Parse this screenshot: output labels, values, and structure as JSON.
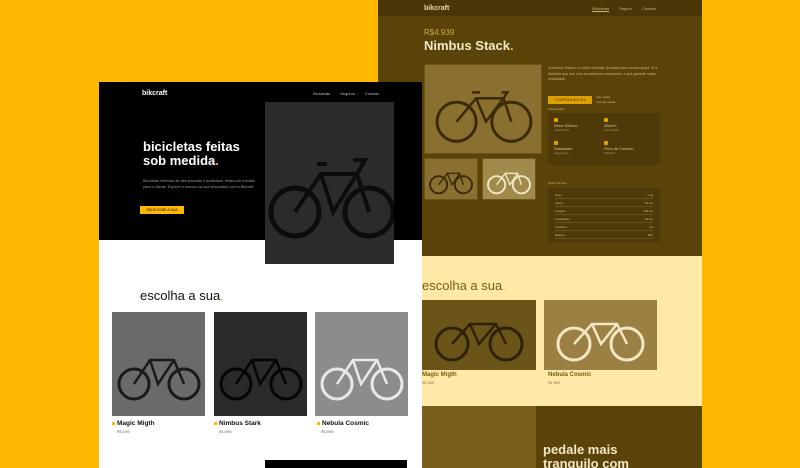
{
  "back": {
    "nav": {
      "logo": "bikcraft",
      "links": [
        "Bicicletas",
        "Seguro",
        "Contato"
      ]
    },
    "price": "R$4.939",
    "title": "Nimbus Stack",
    "desc": "A Nimbus Stack é a melhor bikcraft, já criada pela nossa equipe. É a bicicleta que une com as melhores acessórios, e que garante maior velocidade.",
    "button": "COMPRAR AGORA",
    "button_note": [
      "frete grátis",
      "entrega rápida"
    ],
    "info_label": "Informações",
    "info": [
      {
        "t": "Motor Elétrico",
        "s": "Assistência"
      },
      {
        "t": "40km/h",
        "s": "Velocidade"
      },
      {
        "t": "Rastreador",
        "s": "Segurança"
      },
      {
        "t": "Fibra de Carbono",
        "s": "Material"
      }
    ],
    "spec_label": "Ficha Técnica",
    "specs": [
      [
        "Peso",
        "7 kg"
      ],
      [
        "Altura",
        "80 cm"
      ],
      [
        "Largura",
        "160 cm"
      ],
      [
        "Velocidade",
        "40 km"
      ],
      [
        "Câmbios",
        "21"
      ],
      [
        "Bateria",
        "60h"
      ]
    ],
    "lower_heading": "escolha a sua",
    "cards": [
      {
        "name": "Magic Migth",
        "price": "R$ 2499"
      },
      {
        "name": "Nebula Cosmic",
        "price": "R$ 3999"
      }
    ],
    "footer_heading": [
      "pedale mais",
      "tranquilo com"
    ]
  },
  "front": {
    "logo": "bikcraft",
    "nav": [
      "Bicicletas",
      "Seguros",
      "Contato"
    ],
    "hero_heading": "bicicletas feitas sob medida",
    "hero_text": "Bicicletas elétricas de alta precisão e qualidade, feitas sob medida para o cliente. Explore o mundo na sua velocidade com a Bikcraft.",
    "hero_button": "SELECIONE A SUA",
    "section_heading": "escolha a sua",
    "cards": [
      {
        "name": "Magic Migth",
        "price": "R$ 2499"
      },
      {
        "name": "Nimbus Stark",
        "price": "R$ 4999"
      },
      {
        "name": "Nebula Cosmic",
        "price": "R$ 3999"
      }
    ]
  },
  "colors": {
    "brand": "#FFB800",
    "hero_bg": "#000000",
    "tinted_bg": "#5A4309",
    "tinted_light": "#FFE9A8"
  }
}
